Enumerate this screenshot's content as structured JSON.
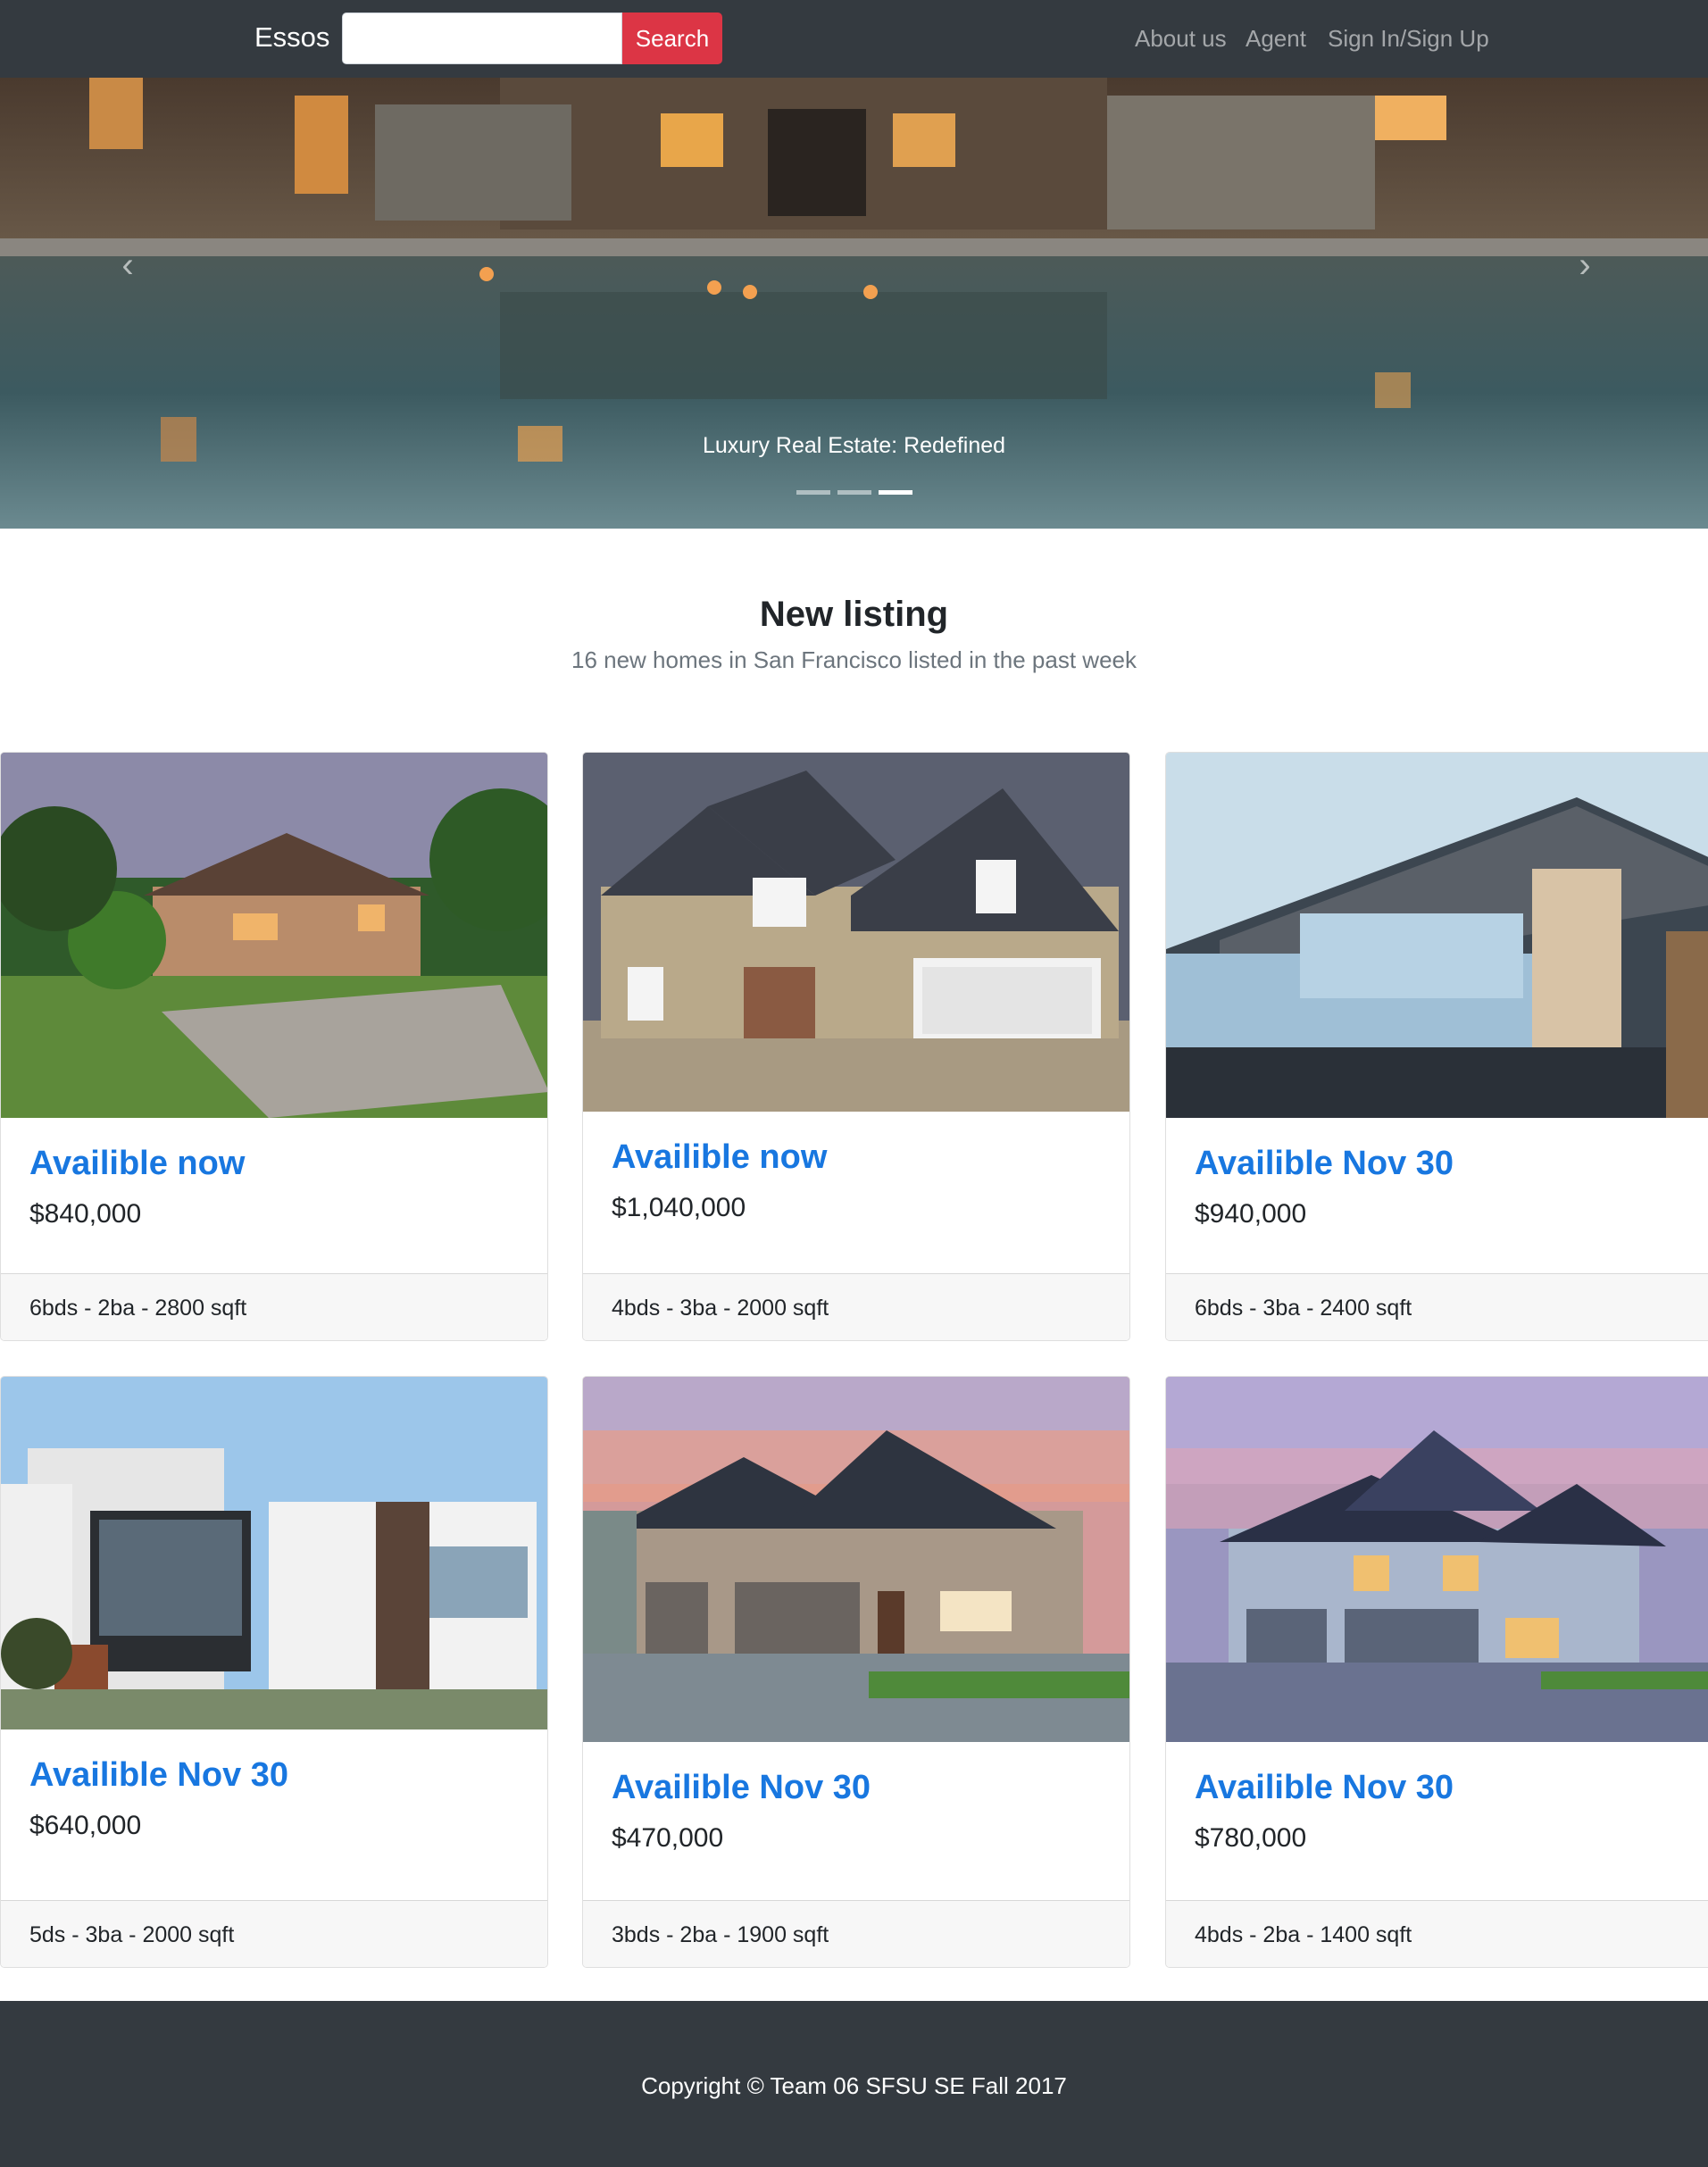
{
  "navbar": {
    "brand": "Essos",
    "search_placeholder": "",
    "search_button": "Search",
    "links": [
      "About us",
      "Agent",
      "Sign In/Sign Up"
    ]
  },
  "carousel": {
    "caption": "Luxury Real Estate: Redefined",
    "slide_count": 3,
    "active_slide": 3,
    "prev_icon": "chevron-left-icon",
    "next_icon": "chevron-right-icon"
  },
  "section": {
    "title": "New listing",
    "subtitle": "16 new homes in San Francisco listed in the past week"
  },
  "listings": [
    {
      "availability": "Availible now",
      "price": "$840,000",
      "details": "6bds - 2ba - 2800 sqft"
    },
    {
      "availability": "Availible now",
      "price": "$1,040,000",
      "details": "4bds - 3ba - 2000 sqft"
    },
    {
      "availability": "Availible Nov 30",
      "price": "$940,000",
      "details": "6bds - 3ba - 2400 sqft"
    },
    {
      "availability": "Availible Nov 30",
      "price": "$640,000",
      "details": "5ds - 3ba - 2000 sqft"
    },
    {
      "availability": "Availible Nov 30",
      "price": "$470,000",
      "details": "3bds - 2ba - 1900 sqft"
    },
    {
      "availability": "Availible Nov 30",
      "price": "$780,000",
      "details": "4bds - 2ba - 1400 sqft"
    }
  ],
  "footer": {
    "copyright": "Copyright © Team 06 SFSU SE Fall 2017"
  },
  "colors": {
    "navbar_bg": "#343a40",
    "search_button": "#dc3545",
    "card_title": "#1877e0",
    "footer_bg": "#343a40"
  }
}
